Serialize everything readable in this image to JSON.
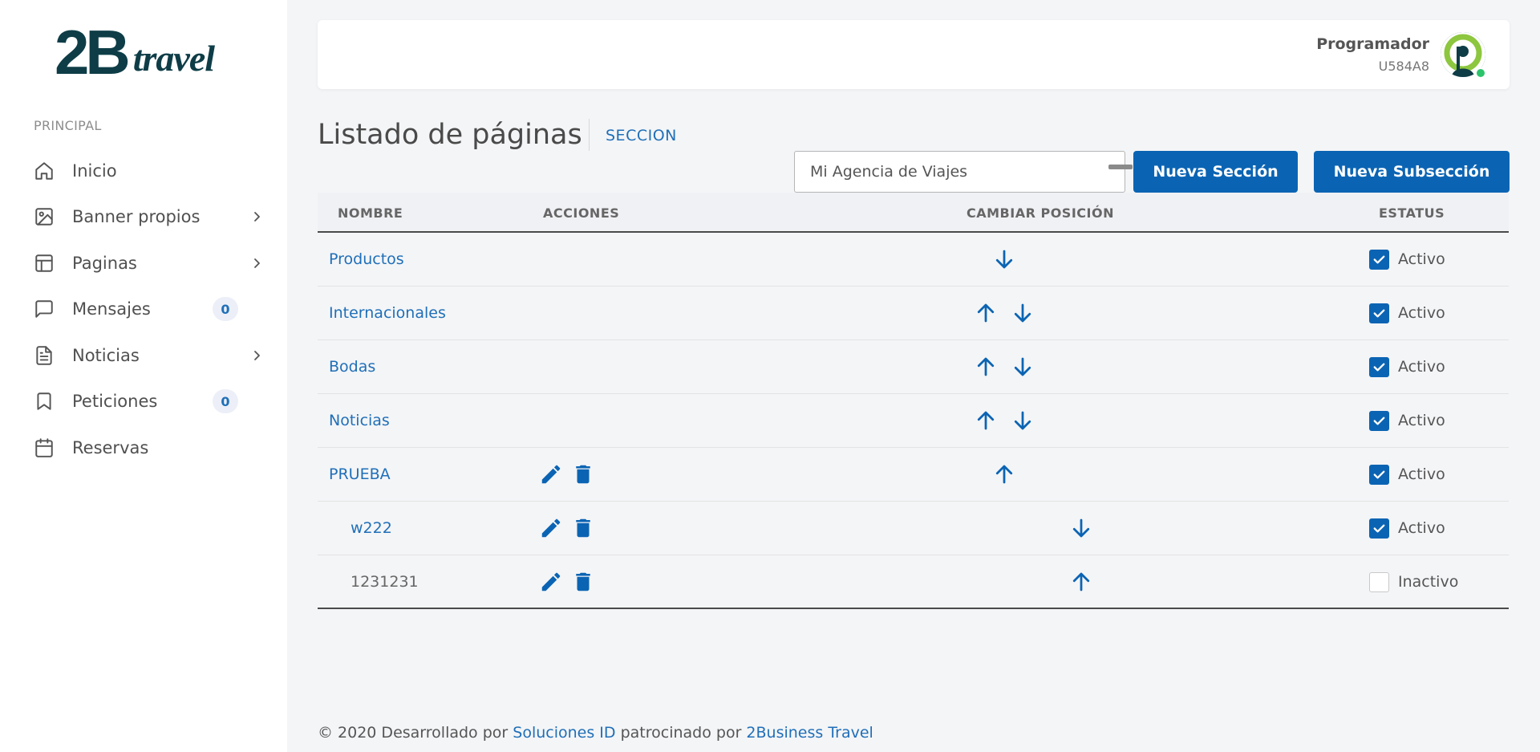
{
  "brand": {
    "logo_main": "2B",
    "logo_sub": "travel"
  },
  "sidebar": {
    "section_label": "PRINCIPAL",
    "items": [
      {
        "label": "Inicio",
        "icon": "home-icon"
      },
      {
        "label": "Banner propios",
        "icon": "image-icon",
        "has_submenu": true
      },
      {
        "label": "Paginas",
        "icon": "layout-icon",
        "has_submenu": true
      },
      {
        "label": "Mensajes",
        "icon": "message-icon",
        "badge": "0"
      },
      {
        "label": "Noticias",
        "icon": "document-icon",
        "has_submenu": true
      },
      {
        "label": "Peticiones",
        "icon": "bookmark-icon",
        "badge": "0"
      },
      {
        "label": "Reservas",
        "icon": "calendar-icon"
      }
    ]
  },
  "user": {
    "name": "Programador",
    "code": "U584A8",
    "status_color": "#2bc46b"
  },
  "page": {
    "title": "Listado de páginas",
    "breadcrumb": "SECCION",
    "agency_select": "Mi Agencia de Viajes",
    "btn_new_section": "Nueva Sección",
    "btn_new_subsection": "Nueva Subsección"
  },
  "table": {
    "headers": {
      "nombre": "NOMBRE",
      "acciones": "ACCIONES",
      "posicion": "CAMBIAR POSICIÓN",
      "estatus": "ESTATUS"
    },
    "rows": [
      {
        "name": "Productos",
        "link": true,
        "actions": false,
        "up": false,
        "down": true,
        "checked": true,
        "status": "Activo",
        "indent": false
      },
      {
        "name": "Internacionales",
        "link": true,
        "actions": false,
        "up": true,
        "down": true,
        "checked": true,
        "status": "Activo",
        "indent": false
      },
      {
        "name": "Bodas",
        "link": true,
        "actions": false,
        "up": true,
        "down": true,
        "checked": true,
        "status": "Activo",
        "indent": false
      },
      {
        "name": "Noticias",
        "link": true,
        "actions": false,
        "up": true,
        "down": true,
        "checked": true,
        "status": "Activo",
        "indent": false
      },
      {
        "name": "PRUEBA",
        "link": true,
        "actions": true,
        "up": true,
        "down": false,
        "checked": true,
        "status": "Activo",
        "indent": false
      },
      {
        "name": "w222",
        "link": true,
        "actions": true,
        "up": false,
        "down": true,
        "checked": true,
        "status": "Activo",
        "indent": true
      },
      {
        "name": "1231231",
        "link": false,
        "actions": true,
        "up": true,
        "down": false,
        "checked": false,
        "status": "Inactivo",
        "indent": true
      }
    ]
  },
  "footer": {
    "prefix": "© 2020 Desarrollado por ",
    "link1": "Soluciones ID",
    "middle": " patrocinado por ",
    "link2": "2Business Travel"
  },
  "colors": {
    "primary": "#0b64b3",
    "link": "#1f6fb8",
    "logo": "#0e3d47"
  }
}
